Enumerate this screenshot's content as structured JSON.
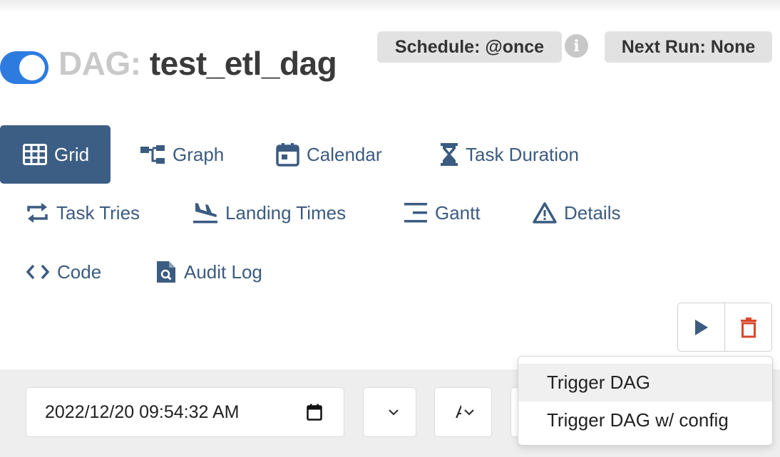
{
  "dag": {
    "prefix": "DAG:",
    "id": "test_etl_dag",
    "paused_toggle_on": true,
    "schedule_label": "Schedule: @once",
    "next_run_label": "Next Run: None"
  },
  "nav": {
    "grid": "Grid",
    "graph": "Graph",
    "calendar": "Calendar",
    "task_duration": "Task Duration",
    "task_tries": "Task Tries",
    "landing_times": "Landing Times",
    "gantt": "Gantt",
    "details": "Details",
    "code": "Code",
    "audit_log": "Audit Log"
  },
  "filter": {
    "base_date": "2022/12/20 09:54:32 AM",
    "partial_select_text": "A"
  },
  "trigger_menu": {
    "items": [
      "Trigger DAG",
      "Trigger DAG w/ config"
    ]
  },
  "colors": {
    "accent": "#3d5e84",
    "toggle": "#2e7be0",
    "delete": "#d9472b"
  }
}
